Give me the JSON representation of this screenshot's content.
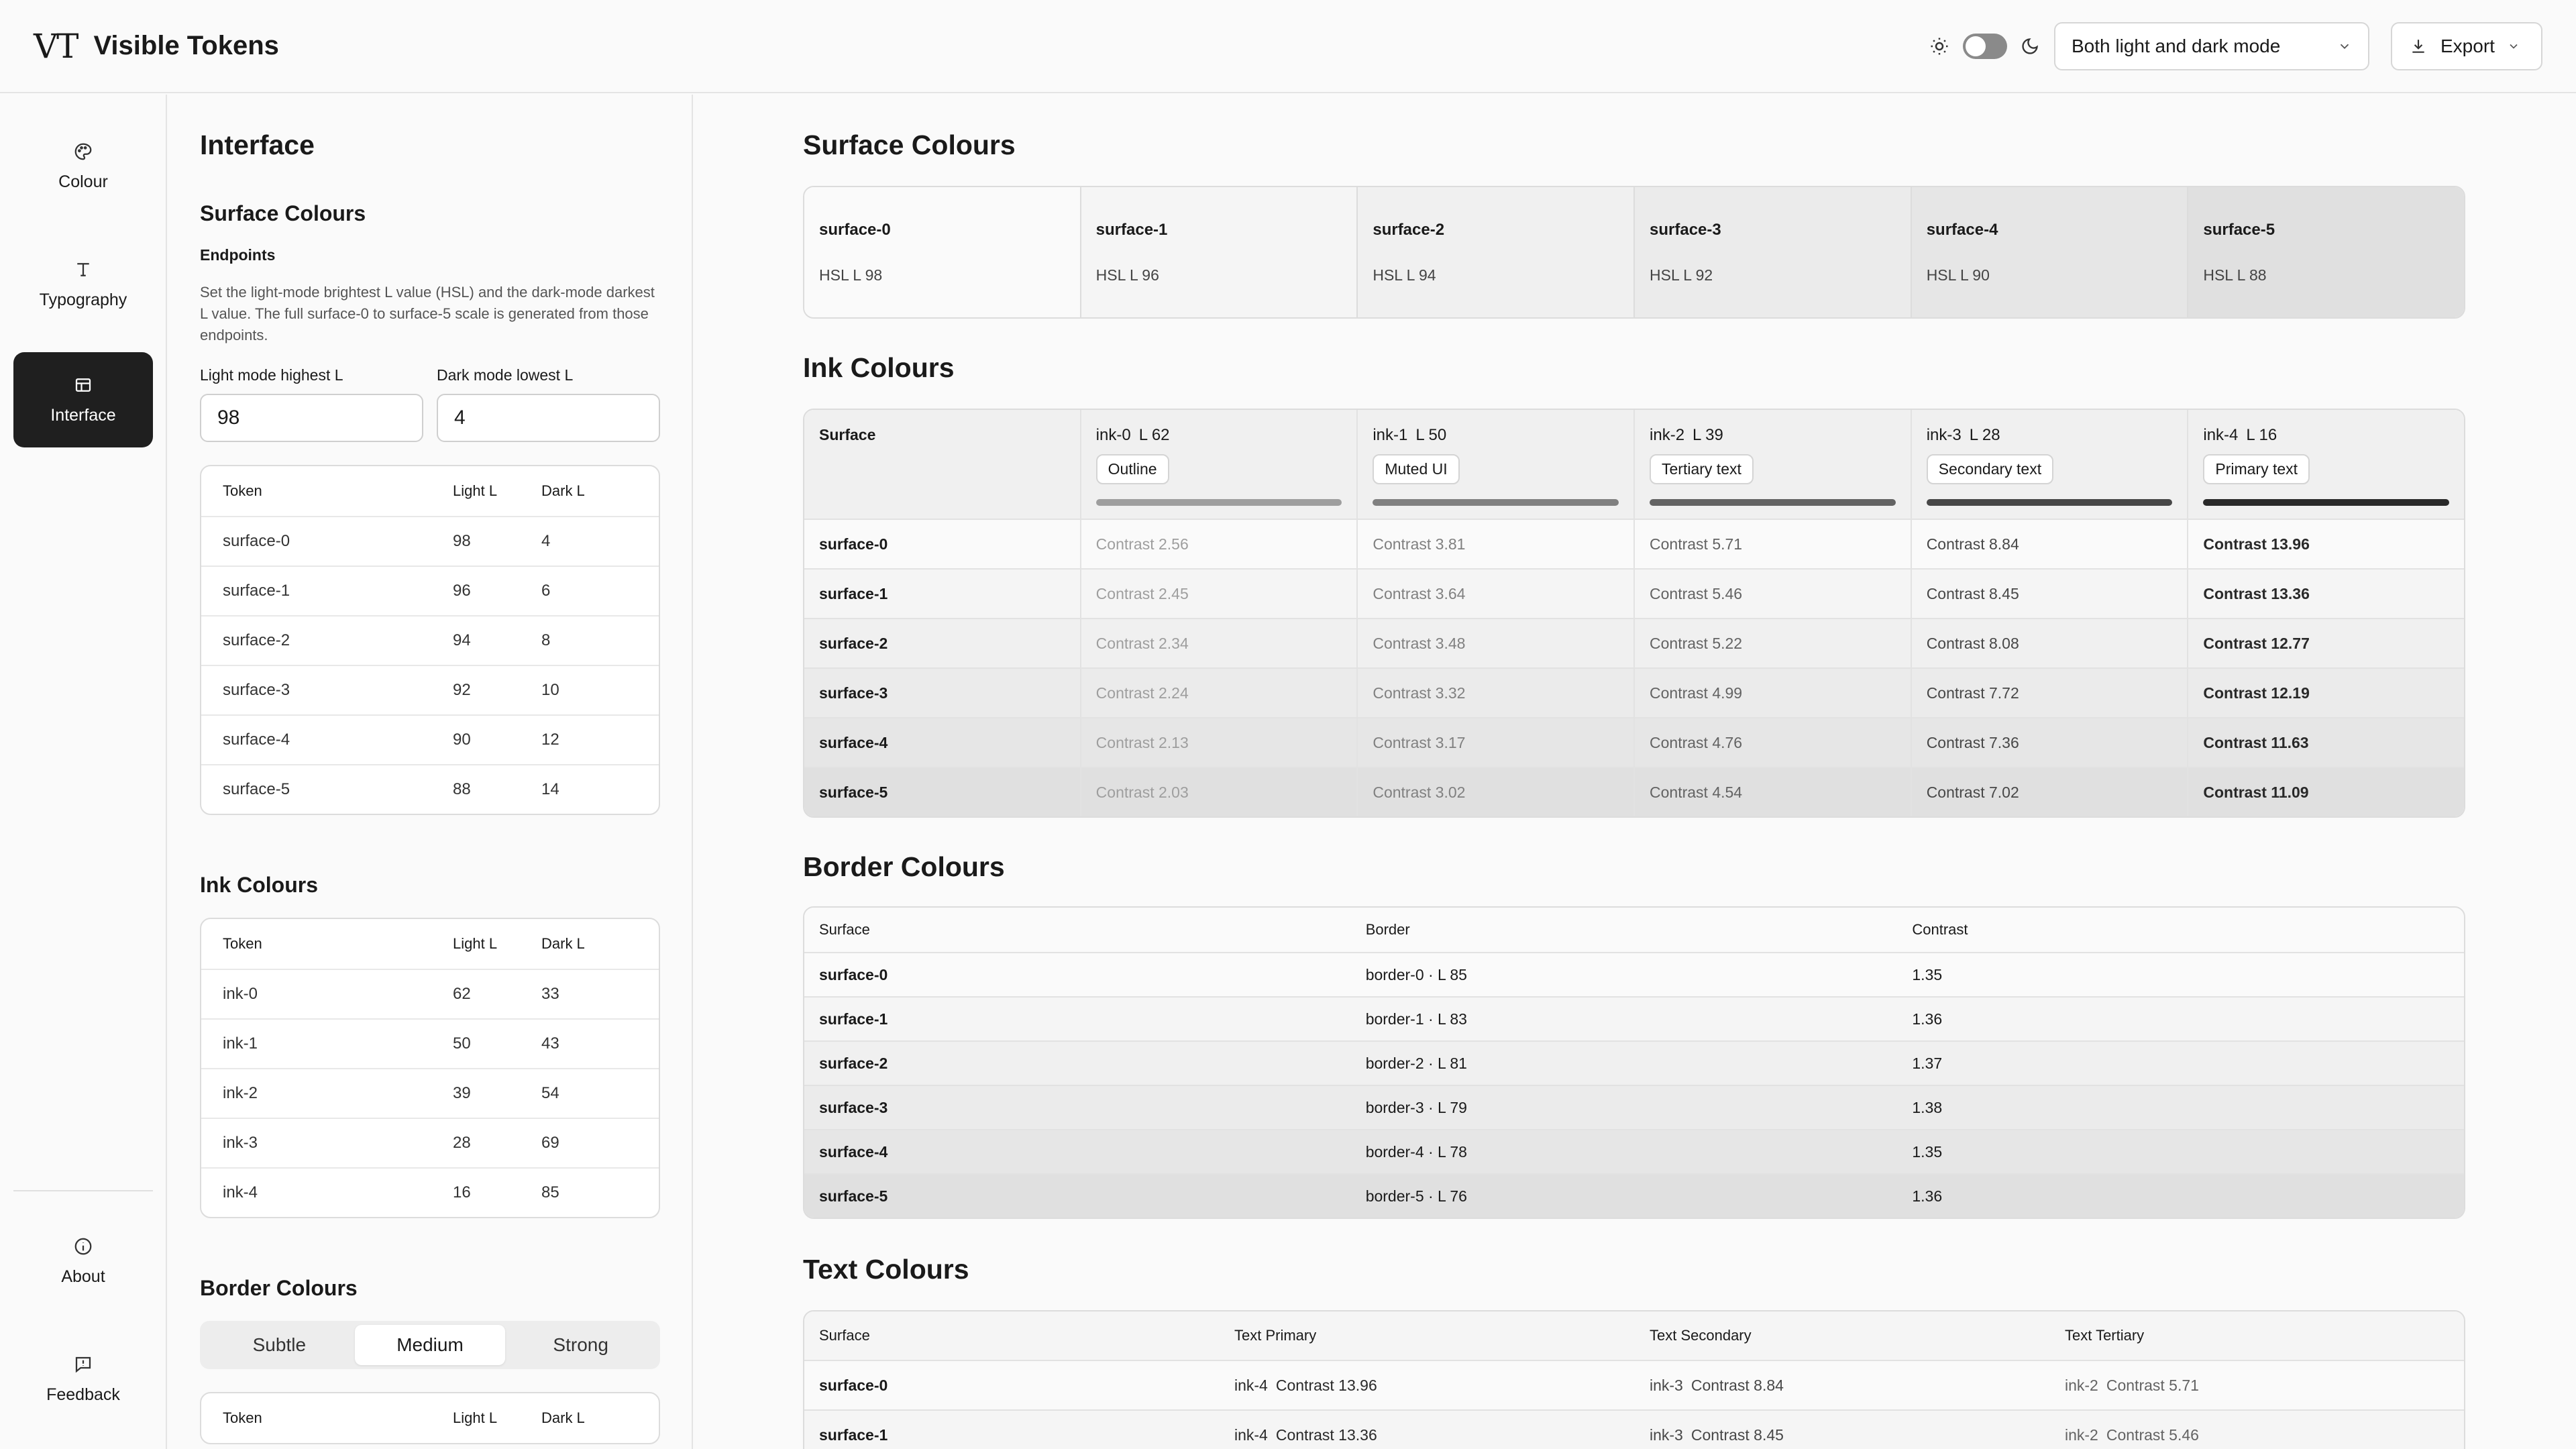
{
  "app": {
    "logo": "VT",
    "title": "Visible Tokens"
  },
  "header": {
    "mode_select": "Both light and dark mode",
    "export_label": "Export"
  },
  "rail": {
    "items": [
      {
        "label": "Colour",
        "icon": "palette-icon"
      },
      {
        "label": "Typography",
        "icon": "type-icon"
      },
      {
        "label": "Interface",
        "icon": "layout-icon"
      },
      {
        "label": "About",
        "icon": "info-icon"
      },
      {
        "label": "Feedback",
        "icon": "feedback-icon"
      }
    ]
  },
  "panel": {
    "title": "Interface",
    "surface": {
      "heading": "Surface Colours",
      "endpoints_label": "Endpoints",
      "description": "Set the light-mode brightest L value (HSL) and the dark-mode darkest L value. The full surface-0 to surface-5 scale is generated from those endpoints.",
      "light_label": "Light mode highest L",
      "light_value": "98",
      "dark_label": "Dark mode lowest L",
      "dark_value": "4",
      "columns": [
        "Token",
        "Light L",
        "Dark L"
      ],
      "rows": [
        [
          "surface-0",
          "98",
          "4"
        ],
        [
          "surface-1",
          "96",
          "6"
        ],
        [
          "surface-2",
          "94",
          "8"
        ],
        [
          "surface-3",
          "92",
          "10"
        ],
        [
          "surface-4",
          "90",
          "12"
        ],
        [
          "surface-5",
          "88",
          "14"
        ]
      ]
    },
    "ink": {
      "heading": "Ink Colours",
      "columns": [
        "Token",
        "Light L",
        "Dark L"
      ],
      "rows": [
        [
          "ink-0",
          "62",
          "33"
        ],
        [
          "ink-1",
          "50",
          "43"
        ],
        [
          "ink-2",
          "39",
          "54"
        ],
        [
          "ink-3",
          "28",
          "69"
        ],
        [
          "ink-4",
          "16",
          "85"
        ]
      ]
    },
    "border": {
      "heading": "Border Colours",
      "segments": [
        "Subtle",
        "Medium",
        "Strong"
      ],
      "active_segment": "Medium",
      "columns": [
        "Token",
        "Light L",
        "Dark L"
      ]
    }
  },
  "main": {
    "surface_title": "Surface Colours",
    "surfaces": [
      {
        "name": "surface-0",
        "hsl": "HSL L 98",
        "color": "#fafafa"
      },
      {
        "name": "surface-1",
        "hsl": "HSL L 96",
        "color": "#f5f5f5"
      },
      {
        "name": "surface-2",
        "hsl": "HSL L 94",
        "color": "#f0f0f0"
      },
      {
        "name": "surface-3",
        "hsl": "HSL L 92",
        "color": "#ebebeb"
      },
      {
        "name": "surface-4",
        "hsl": "HSL L 90",
        "color": "#e6e6e6"
      },
      {
        "name": "surface-5",
        "hsl": "HSL L 88",
        "color": "#e0e0e0"
      }
    ],
    "ink_title": "Ink Colours",
    "ink_corner": "Surface",
    "inks": [
      {
        "name": "ink-0",
        "l": "L 62",
        "role": "Outline",
        "color": "#9e9e9e"
      },
      {
        "name": "ink-1",
        "l": "L 50",
        "role": "Muted UI",
        "color": "#808080"
      },
      {
        "name": "ink-2",
        "l": "L 39",
        "role": "Tertiary text",
        "color": "#636363"
      },
      {
        "name": "ink-3",
        "l": "L 28",
        "role": "Secondary text",
        "color": "#474747"
      },
      {
        "name": "ink-4",
        "l": "L 16",
        "role": "Primary text",
        "color": "#292929"
      }
    ],
    "ink_rows": [
      {
        "surface": "surface-0",
        "values": [
          "Contrast 2.56",
          "Contrast 3.81",
          "Contrast 5.71",
          "Contrast 8.84",
          "Contrast 13.96"
        ]
      },
      {
        "surface": "surface-1",
        "values": [
          "Contrast 2.45",
          "Contrast 3.64",
          "Contrast 5.46",
          "Contrast 8.45",
          "Contrast 13.36"
        ]
      },
      {
        "surface": "surface-2",
        "values": [
          "Contrast 2.34",
          "Contrast 3.48",
          "Contrast 5.22",
          "Contrast 8.08",
          "Contrast 12.77"
        ]
      },
      {
        "surface": "surface-3",
        "values": [
          "Contrast 2.24",
          "Contrast 3.32",
          "Contrast 4.99",
          "Contrast 7.72",
          "Contrast 12.19"
        ]
      },
      {
        "surface": "surface-4",
        "values": [
          "Contrast 2.13",
          "Contrast 3.17",
          "Contrast 4.76",
          "Contrast 7.36",
          "Contrast 11.63"
        ]
      },
      {
        "surface": "surface-5",
        "values": [
          "Contrast 2.03",
          "Contrast 3.02",
          "Contrast 4.54",
          "Contrast 7.02",
          "Contrast 11.09"
        ]
      }
    ],
    "border_title": "Border Colours",
    "border_columns": [
      "Surface",
      "Border",
      "Contrast"
    ],
    "border_rows": [
      [
        "surface-0",
        "border-0 · L 85",
        "1.35"
      ],
      [
        "surface-1",
        "border-1 · L 83",
        "1.36"
      ],
      [
        "surface-2",
        "border-2 · L 81",
        "1.37"
      ],
      [
        "surface-3",
        "border-3 · L 79",
        "1.38"
      ],
      [
        "surface-4",
        "border-4 · L 78",
        "1.35"
      ],
      [
        "surface-5",
        "border-5 · L 76",
        "1.36"
      ]
    ],
    "text_title": "Text Colours",
    "text_columns": [
      "Surface",
      "Text Primary",
      "Text Secondary",
      "Text Tertiary"
    ],
    "text_rows": [
      [
        "surface-0",
        "ink-4",
        "Contrast 13.96",
        "ink-3",
        "Contrast 8.84",
        "ink-2",
        "Contrast 5.71"
      ],
      [
        "surface-1",
        "ink-4",
        "Contrast 13.36",
        "ink-3",
        "Contrast 8.45",
        "ink-2",
        "Contrast 5.46"
      ]
    ]
  }
}
